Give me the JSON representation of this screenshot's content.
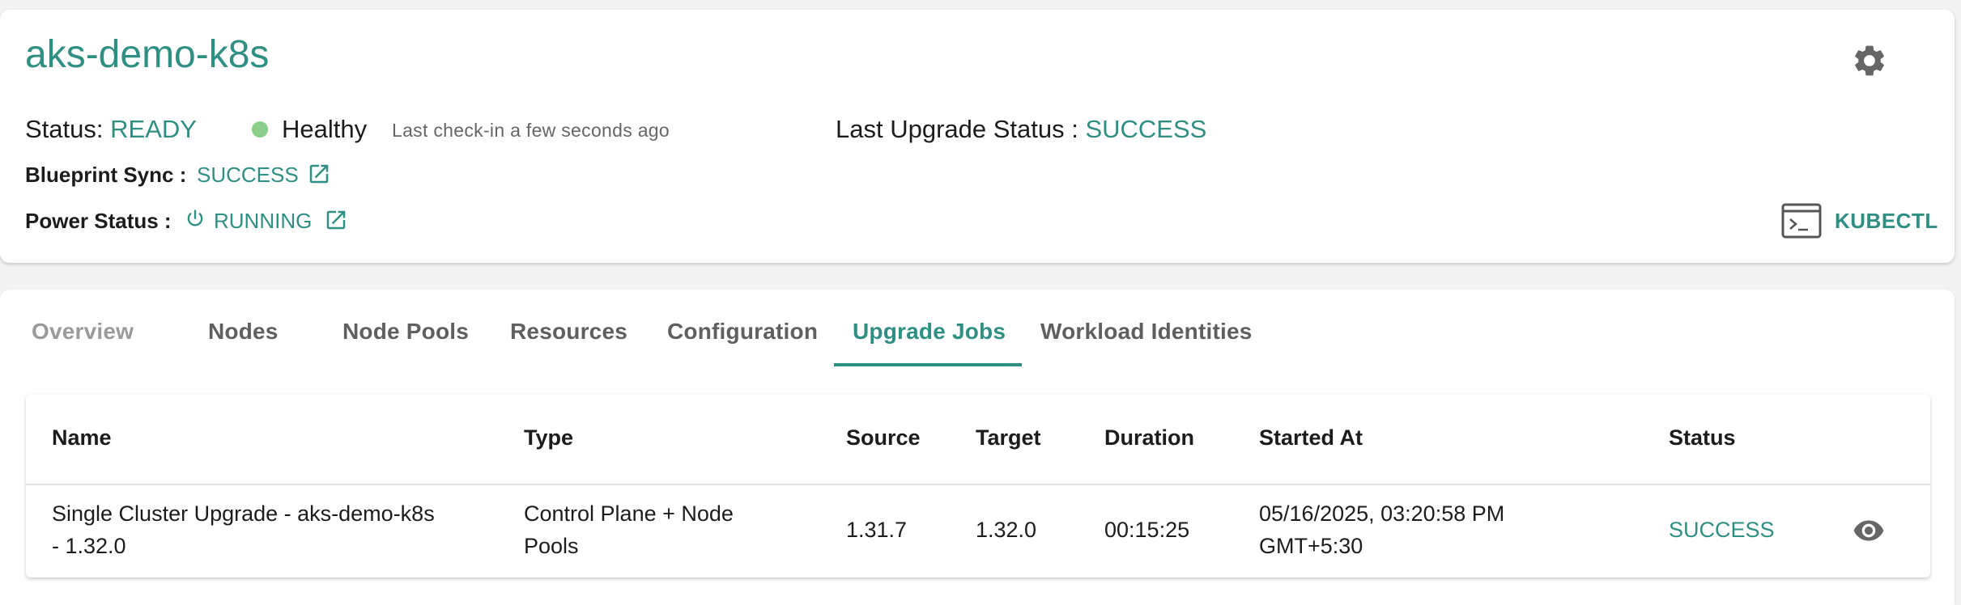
{
  "cluster": {
    "name": "aks-demo-k8s",
    "status_label": "Status:",
    "status_value": "READY",
    "health_label": "Healthy",
    "checkin_text": "Last check-in a few seconds ago",
    "last_upgrade_label": "Last Upgrade Status :",
    "last_upgrade_value": "SUCCESS",
    "blueprint_label": "Blueprint Sync :",
    "blueprint_value": "SUCCESS",
    "power_label": "Power Status :",
    "power_value": "RUNNING",
    "kubectl_label": "KUBECTL"
  },
  "colors": {
    "accent": "#2f8f83",
    "healthy": "#8bcf8b"
  },
  "icons": [
    "gear-icon",
    "external-link-icon",
    "power-icon",
    "terminal-icon",
    "eye-icon"
  ],
  "tabs": [
    {
      "label": "Overview",
      "active": false
    },
    {
      "label": "Nodes",
      "active": false
    },
    {
      "label": "Node Pools",
      "active": false
    },
    {
      "label": "Resources",
      "active": false
    },
    {
      "label": "Configuration",
      "active": false
    },
    {
      "label": "Upgrade Jobs",
      "active": true
    },
    {
      "label": "Workload Identities",
      "active": false
    }
  ],
  "table": {
    "columns": [
      "Name",
      "Type",
      "Source",
      "Target",
      "Duration",
      "Started At",
      "Status"
    ],
    "rows": [
      {
        "name_line1": "Single Cluster Upgrade - aks-demo-k8s",
        "name_line2": "- 1.32.0",
        "type_line1": "Control Plane + Node",
        "type_line2": "Pools",
        "source": "1.31.7",
        "target": "1.32.0",
        "duration": "00:15:25",
        "started_line1": "05/16/2025, 03:20:58 PM",
        "started_line2": "GMT+5:30",
        "status": "SUCCESS"
      }
    ]
  }
}
